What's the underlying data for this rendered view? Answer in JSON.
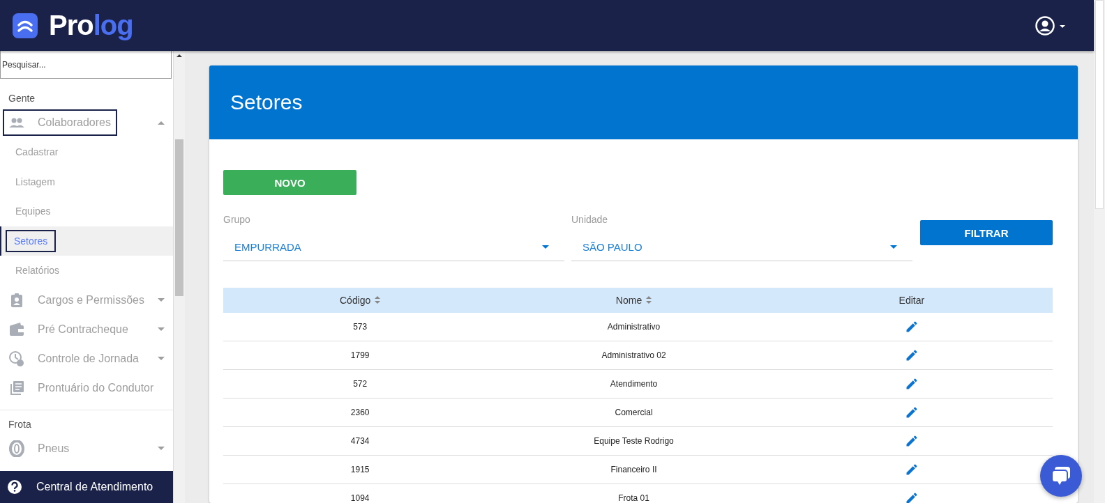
{
  "header": {
    "logo_part_1": "Pro",
    "logo_part_2": "log"
  },
  "sidebar": {
    "search": {
      "placeholder": "Pesquisar..."
    },
    "sections": [
      {
        "label": "Gente",
        "items": [
          {
            "label": "Colaboradores",
            "expanded": true,
            "outlined": true,
            "children": [
              {
                "label": "Cadastrar",
                "selected": false,
                "outlined": false
              },
              {
                "label": "Listagem",
                "selected": false,
                "outlined": false
              },
              {
                "label": "Equipes",
                "selected": false,
                "outlined": false
              },
              {
                "label": "Setores",
                "selected": true,
                "outlined": true
              },
              {
                "label": "Relatórios",
                "selected": false,
                "outlined": false
              }
            ]
          },
          {
            "label": "Cargos e Permissões",
            "expanded": false,
            "outlined": false
          },
          {
            "label": "Pré Contracheque",
            "expanded": false,
            "outlined": false
          },
          {
            "label": "Controle de Jornada",
            "expanded": false,
            "outlined": false
          },
          {
            "label": "Prontuário do Condutor",
            "outlined": false
          }
        ]
      },
      {
        "label": "Frota",
        "items": [
          {
            "label": "Pneus",
            "expanded": false,
            "outlined": false
          }
        ]
      }
    ],
    "footer": "Central de Atendimento"
  },
  "card": {
    "title": "Setores",
    "new_button": "NOVO",
    "filters": [
      {
        "label": "Grupo",
        "value": "EMPURRADA"
      },
      {
        "label": "Unidade",
        "value": "SÃO PAULO"
      }
    ],
    "filter_button": "FILTRAR",
    "table": {
      "columns": [
        {
          "label": "Código",
          "sortable": true
        },
        {
          "label": "Nome",
          "sortable": true
        },
        {
          "label": "Editar",
          "sortable": false
        }
      ],
      "rows": [
        {
          "code": "573",
          "name": "Administrativo"
        },
        {
          "code": "1799",
          "name": "Administrativo 02"
        },
        {
          "code": "572",
          "name": "Atendimento"
        },
        {
          "code": "2360",
          "name": "Comercial"
        },
        {
          "code": "4734",
          "name": "Equipe Teste Rodrigo"
        },
        {
          "code": "1915",
          "name": "Financeiro II"
        },
        {
          "code": "1094",
          "name": "Frota 01"
        }
      ]
    }
  }
}
